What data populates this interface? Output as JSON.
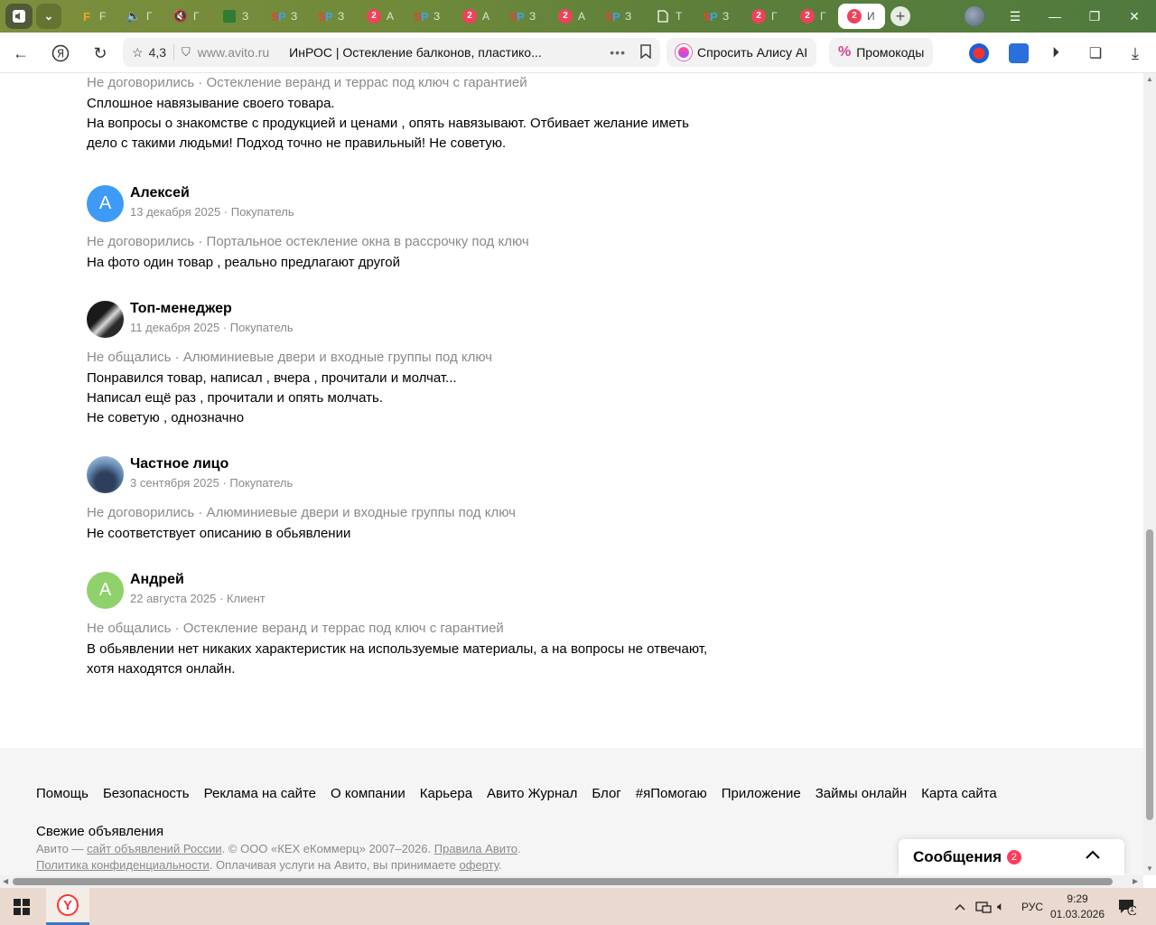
{
  "browser": {
    "tabs": [
      {
        "kind": "audio",
        "label": ""
      },
      {
        "kind": "dropdown",
        "label": ""
      },
      {
        "kind": "F",
        "label": "F"
      },
      {
        "kind": "mute",
        "label": "Г"
      },
      {
        "kind": "mute-red",
        "label": "Г"
      },
      {
        "kind": "green",
        "label": "З"
      },
      {
        "kind": "sp",
        "label": "З"
      },
      {
        "kind": "sp",
        "label": "З"
      },
      {
        "kind": "badge",
        "label": "А"
      },
      {
        "kind": "sp",
        "label": "З"
      },
      {
        "kind": "badge",
        "label": "А"
      },
      {
        "kind": "sp",
        "label": "З"
      },
      {
        "kind": "badge",
        "label": "А"
      },
      {
        "kind": "sp",
        "label": "З"
      },
      {
        "kind": "doc",
        "label": "Т"
      },
      {
        "kind": "sp",
        "label": "З"
      },
      {
        "kind": "badge",
        "label": "Г"
      },
      {
        "kind": "badge",
        "label": "Г"
      },
      {
        "kind": "badge-active",
        "label": "И"
      }
    ],
    "tab_badge": "2",
    "address": {
      "rating": "4,3",
      "domain": "www.avito.ru",
      "title": "ИнРОС | Остекление балконов, пластико..."
    },
    "alice_label": "Спросить Алису AI",
    "promo_label": "Промокоды"
  },
  "reviews": [
    {
      "name": "",
      "date": "",
      "deal": "Не договорились · Остекление веранд и террас под ключ с гарантией",
      "lines": [
        "Сплошное навязывание своего товара.",
        "На вопросы о знакомстве с продукцией и ценами , опять навязывают. Отбивает желание иметь",
        "дело с такими людьми! Подход точно не правильный! Не советую."
      ]
    },
    {
      "name": "Алексей",
      "initial": "А",
      "avatar_color": "#3d9bf5",
      "date": "13 декабря 2025 · Покупатель",
      "deal": "Не договорились · Портальное остекление окна в рассрочку под ключ",
      "lines": [
        "На фото один товар , реально предлагают другой"
      ]
    },
    {
      "name": "Топ-менеджер",
      "initial": "",
      "avatar_color": "#2a2a2a",
      "date": "11 декабря 2025 · Покупатель",
      "deal": "Не общались · Алюминиевые двери и входные группы под ключ",
      "lines": [
        "Понравился товар, написал , вчера , прочитали и молчат...",
        "Написал ещё раз , прочитали и опять молчать.",
        "Не советую , однозначно"
      ]
    },
    {
      "name": "Частное лицо",
      "initial": "",
      "avatar_color": "#4a6a8a",
      "date": "3 сентября 2025 · Покупатель",
      "deal": "Не договорились · Алюминиевые двери и входные группы под ключ",
      "lines": [
        "Не соответствует описанию в обьявлении"
      ]
    },
    {
      "name": "Андрей",
      "initial": "А",
      "avatar_color": "#8fd16a",
      "date": "22 августа 2025 · Клиент",
      "deal": "Не общались · Остекление веранд и террас под ключ с гарантией",
      "lines": [
        "В обьявлении нет никаких характеристик на используемые материалы, а на вопросы не отвечают,",
        "хотя находятся онлайн."
      ]
    }
  ],
  "footer": {
    "links": [
      "Помощь",
      "Безопасность",
      "Реклама на сайте",
      "О компании",
      "Карьера",
      "Авито Журнал",
      "Блог",
      "#яПомогаю",
      "Приложение",
      "Займы онлайн",
      "Карта сайта",
      "Свежие объявления"
    ],
    "legal": {
      "p1": "Авито — ",
      "link1": "сайт объявлений России",
      "p2": ". © ООО «КЕХ еКоммерц» 2007–2026. ",
      "link2": "Правила Авито",
      "p3": ".",
      "link3": "Политика конфиденциальности",
      "p4": ". Оплачивая услуги на Авито, вы принимаете ",
      "link4": "оферту",
      "p5": "."
    }
  },
  "messages": {
    "label": "Сообщения",
    "count": "2"
  },
  "taskbar": {
    "lang": "РУС",
    "time": "9:29",
    "date": "01.03.2026",
    "notif_count": "1"
  }
}
